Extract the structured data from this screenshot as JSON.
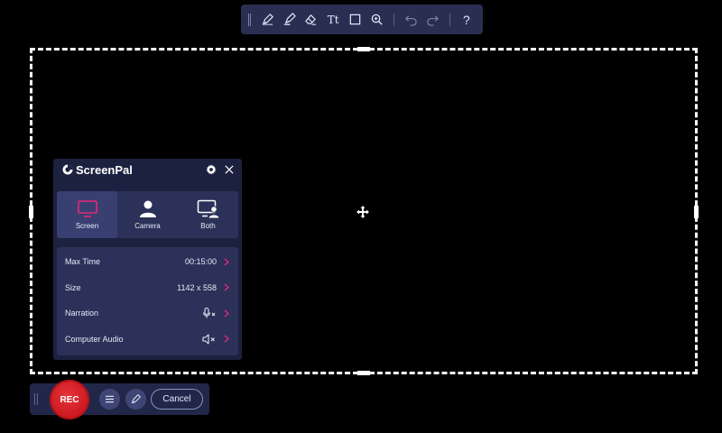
{
  "toolbar": {
    "tools": [
      {
        "name": "pen-icon"
      },
      {
        "name": "highlighter-icon"
      },
      {
        "name": "eraser-icon"
      },
      {
        "name": "text-icon",
        "glyph": "Tt"
      },
      {
        "name": "rectangle-icon"
      },
      {
        "name": "zoom-icon"
      },
      {
        "name": "undo-icon"
      },
      {
        "name": "redo-icon"
      },
      {
        "name": "help-icon",
        "glyph": "?"
      }
    ]
  },
  "panel": {
    "brand": "ScreenPal",
    "modes": [
      {
        "label": "Screen",
        "active": true
      },
      {
        "label": "Camera",
        "active": false
      },
      {
        "label": "Both",
        "active": false
      }
    ],
    "settings": [
      {
        "label": "Max Time",
        "value": "00:15:00"
      },
      {
        "label": "Size",
        "value": "1142 x 558"
      },
      {
        "label": "Narration",
        "value": "",
        "icon": "microphone-muted-icon"
      },
      {
        "label": "Computer Audio",
        "value": "",
        "icon": "speaker-muted-icon"
      }
    ]
  },
  "recbar": {
    "rec_label": "REC",
    "cancel_label": "Cancel"
  },
  "colors": {
    "accent_pink": "#e6287a",
    "rec_red": "#d21d23",
    "panel_bg": "#1c2140"
  }
}
